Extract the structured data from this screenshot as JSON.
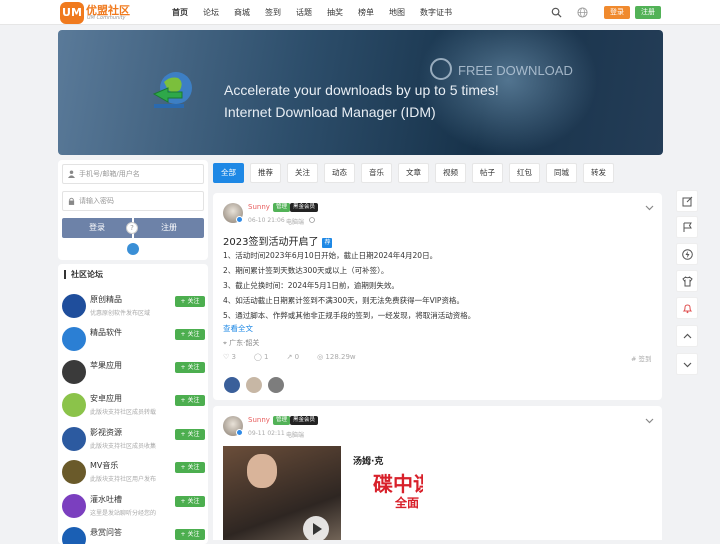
{
  "header": {
    "logo_mark": "UM",
    "logo_text": "优盟社区",
    "logo_sub": "UM Community",
    "nav": [
      "首页",
      "论坛",
      "商城",
      "签到",
      "话题",
      "抽奖",
      "榜单",
      "地图",
      "数字证书"
    ],
    "login_label": "登录",
    "register_label": "注册"
  },
  "banner": {
    "line1": "Accelerate your downloads by up to 5 times!",
    "line2": "Internet Download Manager (IDM)",
    "badge": "FREE DOWNLOAD"
  },
  "login": {
    "account_placeholder": "手机号/邮箱/用户名",
    "password_placeholder": "请输入密码",
    "login_label": "登录",
    "register_label": "注册",
    "or": "?"
  },
  "forum": {
    "title": "社区论坛",
    "follow_label": "+ 关注",
    "items": [
      {
        "name": "原创精品",
        "desc": "优惠原创软件发布区域",
        "color": "#1f4e9c"
      },
      {
        "name": "精品软件",
        "desc": "",
        "color": "#2b7fd4"
      },
      {
        "name": "苹果应用",
        "desc": "",
        "color": "#3a3a3a"
      },
      {
        "name": "安卓应用",
        "desc": "此版块支持社区成员转载",
        "color": "#8bc34a"
      },
      {
        "name": "影视资源",
        "desc": "此版块支持社区成员收集",
        "color": "#2c5aa0"
      },
      {
        "name": "MV音乐",
        "desc": "此版块支持社区用户发布",
        "color": "#6a5a2a"
      },
      {
        "name": "灌水吐槽",
        "desc": "这里是发站聊听分经您的",
        "color": "#7b3fbf"
      },
      {
        "name": "悬赏问答",
        "desc": "",
        "color": "#1a5fb4"
      }
    ]
  },
  "tabs": [
    "全部",
    "推荐",
    "关注",
    "动态",
    "音乐",
    "文章",
    "视频",
    "帖子",
    "红包",
    "同城",
    "转发"
  ],
  "post1": {
    "user": "Sunny",
    "badge1": "管理",
    "badge2": "黑金会员",
    "time": "06-10 21:06",
    "device": "电脑端",
    "title": "2023签到活动开启了",
    "tag": "荐",
    "lines": [
      "1、活动时间2023年6月10日开始，截止日期2024年4月20日。",
      "2、期间累计签到天数达300天或以上（可补签）。",
      "3、截止兑换时间：2024年5月1日前，逾期则失效。",
      "4、如活动截止日期累计签到不满300天，则无法免费获得一年VIP资格。",
      "5、通过脚本、作弊或其他非正规手段的签到，一经发现，将取消活动资格。"
    ],
    "more": "查看全文",
    "location": "广东·韶关",
    "likes": "3",
    "comments": "1",
    "shares": "0",
    "views": "128.29w",
    "sign": "# 签到"
  },
  "post2": {
    "user": "Sunny",
    "badge1": "管理",
    "badge2": "黑金会员",
    "time": "09-11 02:11",
    "device": "电脑端",
    "poster_text": "碟中谍",
    "poster_sub": "全面",
    "poster_top": "汤姆·克"
  }
}
